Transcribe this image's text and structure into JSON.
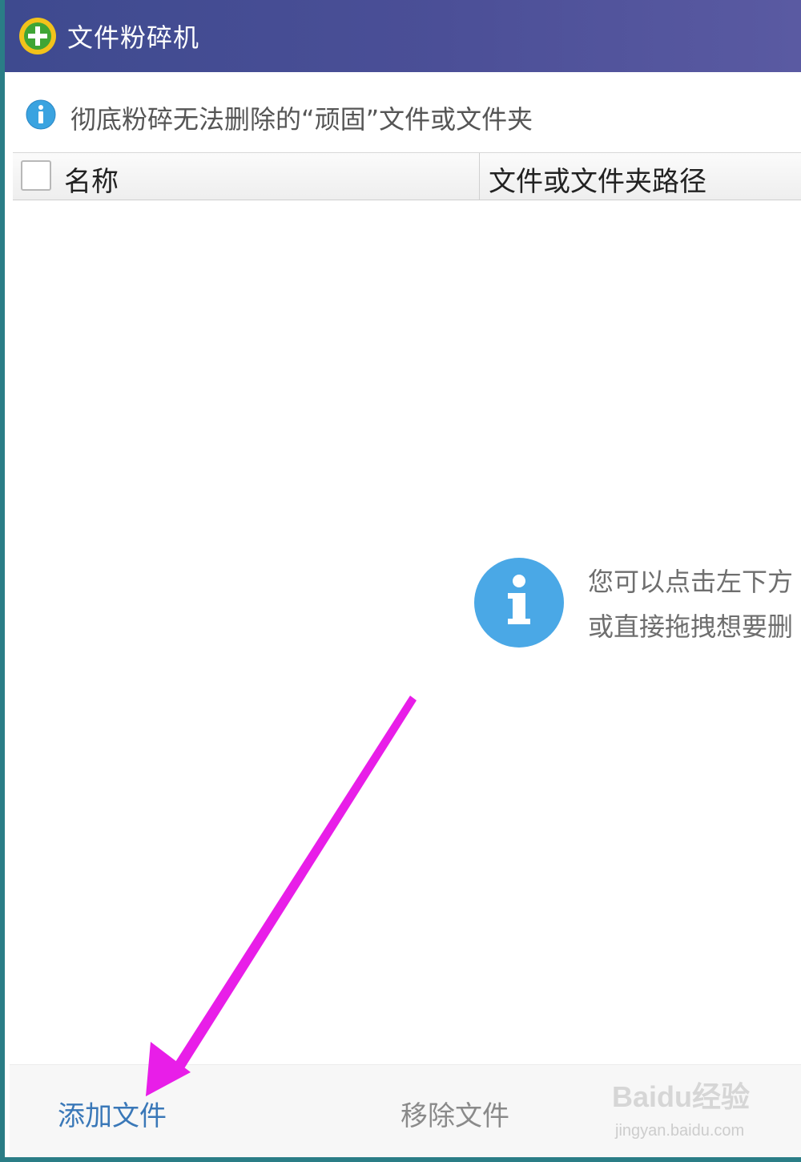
{
  "window": {
    "title": "文件粉碎机"
  },
  "info_bar": {
    "text": "彻底粉碎无法删除的“顽固”文件或文件夹",
    "icon": "info-icon"
  },
  "file_table": {
    "select_all_checked": false,
    "columns": [
      {
        "label": "名称"
      },
      {
        "label": "文件或文件夹路径"
      }
    ],
    "rows": []
  },
  "empty_hint": {
    "icon": "info-icon",
    "line1": "您可以点击左下方",
    "line2": "或直接拖拽想要删"
  },
  "bottom_bar": {
    "add_label": "添加文件",
    "remove_label": "移除文件"
  },
  "watermark": {
    "brand": "Baidu经验",
    "url": "jingyan.baidu.com"
  },
  "colors": {
    "titlebar": "#4b4f97",
    "frame": "#2a7d86",
    "info_blue": "#3aa3e0",
    "link_blue": "#3a78b8",
    "annotation_arrow": "#e81ee8"
  }
}
